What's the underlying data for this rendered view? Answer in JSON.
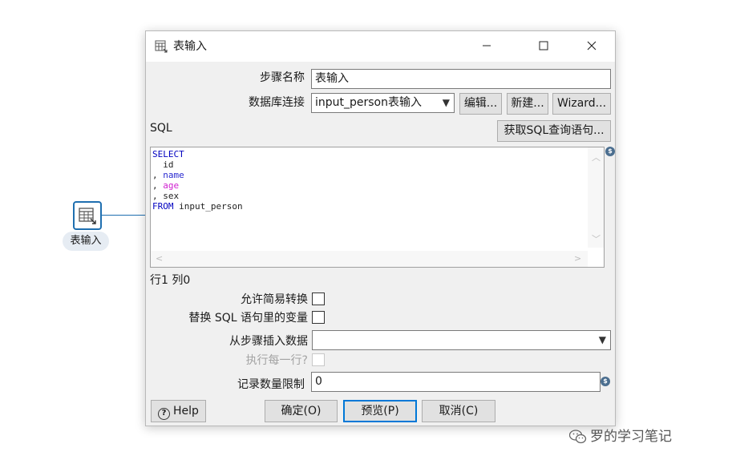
{
  "canvas": {
    "step_label": "表输入"
  },
  "dialog": {
    "title": "表输入",
    "step_name_label": "步骤名称",
    "step_name_value": "表输入",
    "connection_label": "数据库连接",
    "connection_value": "input_person表输入",
    "edit_button": "编辑...",
    "new_button": "新建...",
    "wizard_button": "Wizard...",
    "sql_label": "SQL",
    "get_sql_button": "获取SQL查询语句...",
    "sql": {
      "select": "SELECT",
      "line_id": "  id",
      "comma": ", ",
      "name": "name",
      "age": "age",
      "sex": "sex",
      "from": "FROM",
      "table": " input_person"
    },
    "cursor_position": "行1 列0",
    "lazy_conversion_label": "允许简易转换",
    "replace_variables_label": "替换 SQL 语句里的变量",
    "insert_from_step_label": "从步骤插入数据",
    "insert_from_step_value": "",
    "execute_each_row_label": "执行每一行?",
    "limit_label": "记录数量限制",
    "limit_value": "0",
    "help_button": "Help",
    "ok_button": "确定(O)",
    "preview_button": "预览(P)",
    "cancel_button": "取消(C)"
  },
  "watermark": "罗的学习笔记",
  "colors": {
    "accent": "#0078d7",
    "sql_keyword": "#0000c0",
    "sql_age": "#d020d0"
  }
}
